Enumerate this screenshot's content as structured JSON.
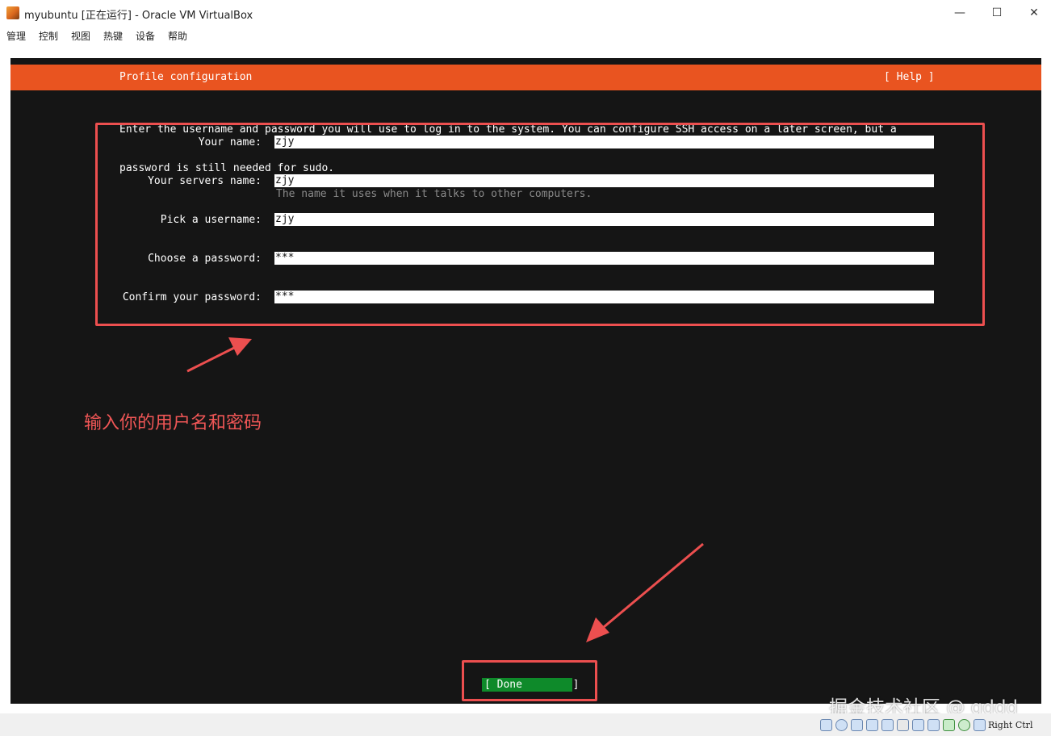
{
  "window": {
    "title": "myubuntu [正在运行] - Oracle VM VirtualBox",
    "minimize": "—",
    "maximize": "☐",
    "close": "✕"
  },
  "menu": [
    "管理",
    "控制",
    "视图",
    "热键",
    "设备",
    "帮助"
  ],
  "installer": {
    "title": "Profile configuration",
    "help": "[ Help ]",
    "intro_line1": "Enter the username and password you will use to log in to the system. You can configure SSH access on a later screen, but a",
    "intro_line2": "password is still needed for sudo.",
    "fields": [
      {
        "label": "Your name:",
        "value": "zjy"
      },
      {
        "label": "Your servers name:",
        "value": "zjy"
      },
      {
        "label": "Pick a username:",
        "value": "zjy"
      },
      {
        "label": "Choose a password:",
        "value": "***"
      },
      {
        "label": "Confirm your password:",
        "value": "***"
      }
    ],
    "server_name_hint": "The name it uses when it talks to other computers.",
    "done_button": "[ Done        ]"
  },
  "annotation": {
    "text": "输入你的用户名和密码",
    "color": "#ec4f4f"
  },
  "statusbar": {
    "host_key": "Right Ctrl"
  },
  "watermark": "掘金技术社区 @ qddd",
  "colors": {
    "header": "#e95420",
    "background": "#151515",
    "done": "#0e8a2a"
  }
}
